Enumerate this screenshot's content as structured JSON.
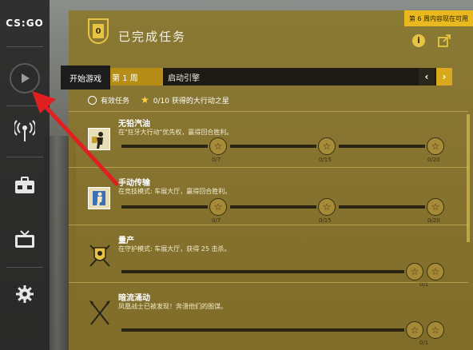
{
  "logo": "CS:GO",
  "sidebar": {
    "tooltip": "开始游戏"
  },
  "panel": {
    "badge_number": "0",
    "title": "已完成任务",
    "week_badge": "第 6 周内容现在可用"
  },
  "week_bar": {
    "week_label": "第 1 周",
    "operation": "启动引擎"
  },
  "filters": {
    "active_missions": "有效任务",
    "stars_text": "0/10 获得的大行动之星"
  },
  "missions": [
    {
      "title": "无铅汽油",
      "desc": "在\"狂牙大行动\"优先权，赢得回合胜利。",
      "counts": [
        "0/7",
        "0/15",
        "0/20"
      ]
    },
    {
      "title": "手动传输",
      "desc": "在竞技模式: 车展大厅，赢得回合胜利。",
      "counts": [
        "0/7",
        "0/15",
        "0/20"
      ]
    },
    {
      "title": "量产",
      "desc": "在守护模式: 车展大厅，获得 25 击杀。",
      "counts": [
        "0/1"
      ]
    },
    {
      "title": "暗流涌动",
      "desc": "凤凰战士已被发现！奔溃他们的图谋。",
      "counts": [
        "0/1"
      ]
    }
  ],
  "colors": {
    "panel": "#8a7628",
    "accent": "#e8c343",
    "arrow": "#e02020"
  }
}
